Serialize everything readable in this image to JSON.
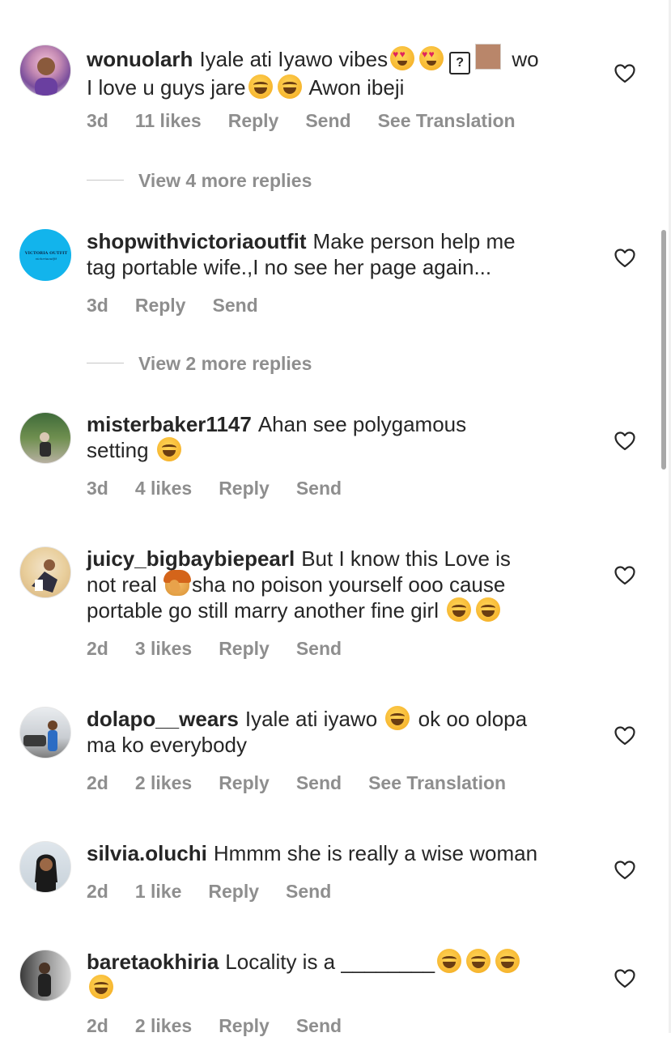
{
  "comments": [
    {
      "username": "wonuolarh",
      "text_parts": [
        "Iyale ati Iyawo vibes",
        "wo",
        "I love u guys jare",
        "Awon ibeji"
      ],
      "unknown_glyph": "?",
      "time": "3d",
      "likes": "11 likes",
      "reply": "Reply",
      "send": "Send",
      "translate": "See Translation"
    },
    {
      "username": "shopwithvictoriaoutfit",
      "text_parts": [
        "Make person help me",
        "tag portable wife.,I no see her page again..."
      ],
      "avatar_text": [
        "VICTORIA OUTFIT",
        "victoriaoutfit"
      ],
      "time": "3d",
      "reply": "Reply",
      "send": "Send"
    },
    {
      "username": "misterbaker1147",
      "text_parts": [
        "Ahan see polygamous",
        "setting"
      ],
      "time": "3d",
      "likes": "4 likes",
      "reply": "Reply",
      "send": "Send"
    },
    {
      "username": "juicy_bigbaybiepearl",
      "text_parts": [
        "But I know this Love is",
        "not real",
        "sha no poison yourself ooo cause",
        "portable go still marry another fine girl"
      ],
      "time": "2d",
      "likes": "3 likes",
      "reply": "Reply",
      "send": "Send"
    },
    {
      "username": "dolapo__wears",
      "text_parts": [
        "Iyale ati iyawo",
        "ok oo olopa",
        "ma ko everybody"
      ],
      "time": "2d",
      "likes": "2 likes",
      "reply": "Reply",
      "send": "Send",
      "translate": "See Translation"
    },
    {
      "username": "silvia.oluchi",
      "text_parts": [
        "Hmmm she is really a wise woman"
      ],
      "time": "2d",
      "likes": "1 like",
      "reply": "Reply",
      "send": "Send"
    },
    {
      "username": "baretaokhiria",
      "text_parts": [
        "Locality is a ________"
      ],
      "time": "2d",
      "likes": "2 likes",
      "reply": "Reply",
      "send": "Send"
    }
  ],
  "view_more": [
    "View 4 more replies",
    "View 2 more replies"
  ],
  "icons": {
    "like": "heart-outline-icon",
    "emoji_laugh": "face-with-tears-of-joy",
    "emoji_hearts": "smiling-face-with-heart-eyes",
    "emoji_facepalm": "person-facepalming"
  },
  "colors": {
    "primary_text": "#262626",
    "secondary_text": "#8e8e8e",
    "background": "#ffffff"
  }
}
